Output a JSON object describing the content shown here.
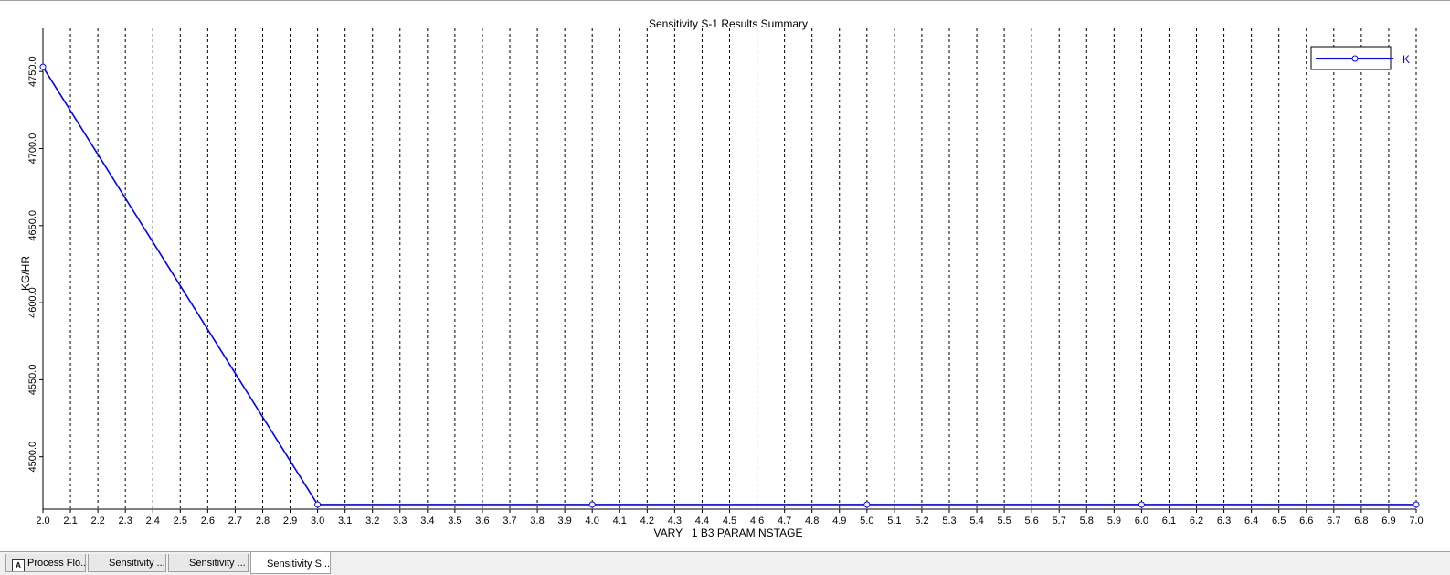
{
  "chart_data": {
    "type": "line",
    "title": "Sensitivity S-1 Results Summary",
    "xlabel": "VARY   1 B3 PARAM NSTAGE",
    "ylabel": "KG/HR",
    "xlim": [
      2.0,
      7.0
    ],
    "ylim": [
      4466,
      4778
    ],
    "x_ticks": [
      "2.0",
      "2.1",
      "2.2",
      "2.3",
      "2.4",
      "2.5",
      "2.6",
      "2.7",
      "2.8",
      "2.9",
      "3.0",
      "3.1",
      "3.2",
      "3.3",
      "3.4",
      "3.5",
      "3.6",
      "3.7",
      "3.8",
      "3.9",
      "4.0",
      "4.1",
      "4.2",
      "4.3",
      "4.4",
      "4.5",
      "4.6",
      "4.7",
      "4.8",
      "4.9",
      "5.0",
      "5.1",
      "5.2",
      "5.3",
      "5.4",
      "5.5",
      "5.6",
      "5.7",
      "5.8",
      "5.9",
      "6.0",
      "6.1",
      "6.2",
      "6.3",
      "6.4",
      "6.5",
      "6.6",
      "6.7",
      "6.8",
      "6.9",
      "7.0"
    ],
    "y_ticks": [
      "4500.0",
      "4550.0",
      "4600.0",
      "4650.0",
      "4700.0",
      "4750.0"
    ],
    "grid": "vertical dashed",
    "legend_position": "top-right",
    "series": [
      {
        "name": "K",
        "color": "#0000ff",
        "x": [
          2,
          3,
          4,
          5,
          6,
          7
        ],
        "y": [
          4753,
          4469,
          4469,
          4469,
          4469,
          4469
        ]
      }
    ]
  },
  "tabs": [
    {
      "label": "Process Flo...",
      "icon": "flowsheet-icon"
    },
    {
      "label": "Sensitivity ..."
    },
    {
      "label": "Sensitivity ..."
    },
    {
      "label": "Sensitivity S..."
    }
  ]
}
